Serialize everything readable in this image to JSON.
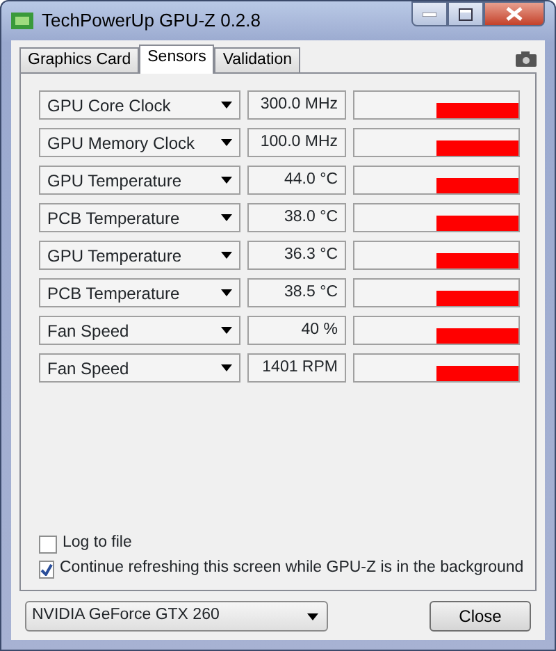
{
  "window": {
    "title": "TechPowerUp GPU-Z 0.2.8"
  },
  "tabs": [
    {
      "label": "Graphics Card",
      "selected": false
    },
    {
      "label": "Sensors",
      "selected": true
    },
    {
      "label": "Validation",
      "selected": false
    }
  ],
  "sensors": [
    {
      "name": "GPU Core Clock",
      "reading": "300.0 MHz"
    },
    {
      "name": "GPU Memory Clock",
      "reading": "100.0 MHz"
    },
    {
      "name": "GPU Temperature",
      "reading": "44.0 °C"
    },
    {
      "name": "PCB Temperature",
      "reading": "38.0 °C"
    },
    {
      "name": "GPU Temperature",
      "reading": "36.3 °C"
    },
    {
      "name": "PCB Temperature",
      "reading": "38.5 °C"
    },
    {
      "name": "Fan Speed",
      "reading": "40 %"
    },
    {
      "name": "Fan Speed",
      "reading": "1401 RPM"
    }
  ],
  "options": [
    {
      "label": "Log to file",
      "checked": false
    },
    {
      "label": "Continue refreshing this screen while GPU-Z is in the background",
      "checked": true
    }
  ],
  "gpu_select": {
    "value": "NVIDIA GeForce GTX 260"
  },
  "buttons": [
    {
      "label": "Close"
    }
  ]
}
